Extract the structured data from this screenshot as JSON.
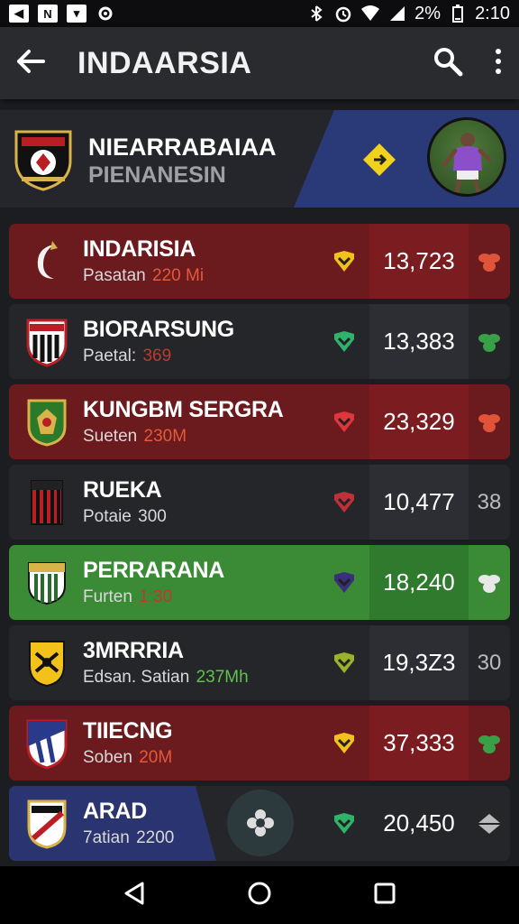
{
  "status_bar": {
    "left_icons": [
      "back-box-icon",
      "notification-n-icon",
      "mail-icon",
      "settings-icon"
    ],
    "battery": "2%",
    "time": "2:10"
  },
  "app_bar": {
    "title": "INDAARSIA"
  },
  "banner": {
    "title": "NIEARRABAIAA",
    "subtitle": "PIENANESIN"
  },
  "rows": [
    {
      "name": "INDARISIA",
      "sub_prefix": "Pasatan",
      "sub_value": "220 Mi",
      "sub_color": "#e25a3a",
      "score": "13,723",
      "tail": "",
      "style": "red",
      "trend_color": "#f2c21b",
      "trend_icon": "down-chevron-icon",
      "tail_icon_color": "#e0553a"
    },
    {
      "name": "BIORARSUNG",
      "sub_prefix": "Paetal:",
      "sub_value": "369",
      "sub_color": "#c0392b",
      "score": "13,383",
      "tail": "",
      "style": "dark",
      "trend_color": "#2fb36a",
      "trend_icon": "down-chevron-icon",
      "tail_icon_color": "#3aa048"
    },
    {
      "name": "KUNGBM SERGRA",
      "sub_prefix": "Sueten",
      "sub_value": "230M",
      "sub_color": "#e25a3a",
      "score": "23,329",
      "tail": "",
      "style": "red",
      "trend_color": "#e0353a",
      "trend_icon": "down-chevron-icon",
      "tail_icon_color": "#e0553a"
    },
    {
      "name": "RUEKA",
      "sub_prefix": "Potaie",
      "sub_value": "300",
      "sub_color": "#d9d9d9",
      "score": "10,477",
      "tail": "38",
      "style": "dark",
      "trend_color": "#c0303a",
      "trend_icon": "down-chevron-icon",
      "tail_icon_color": ""
    },
    {
      "name": "PERRARANA",
      "sub_prefix": "Furten",
      "sub_value": "1:30",
      "sub_color": "#c0392b",
      "score": "18,240",
      "tail": "",
      "style": "green",
      "trend_color": "#3a2f7a",
      "trend_icon": "down-chevron-icon",
      "tail_icon_color": "#e8e8e8"
    },
    {
      "name": "3MRRRIA",
      "sub_prefix": "Edsan. Satian",
      "sub_value": "237Mh",
      "sub_color": "#5fc24a",
      "score": "19,3Z3",
      "tail": "30",
      "style": "dark",
      "trend_color": "#9ab22a",
      "trend_icon": "down-chevron-icon",
      "tail_icon_color": ""
    },
    {
      "name": "TIIECNG",
      "sub_prefix": "Soben",
      "sub_value": "20M",
      "sub_color": "#e25a3a",
      "score": "37,333",
      "tail": "",
      "style": "red",
      "trend_color": "#f2c21b",
      "trend_icon": "down-chevron-icon",
      "tail_icon_color": "#3aa048"
    },
    {
      "name": "ARAD",
      "sub_prefix": "7atian",
      "sub_value": "2200",
      "sub_color": "#d9d9d9",
      "score": "20,450",
      "tail": "",
      "style": "last",
      "trend_color": "#2fb36a",
      "trend_icon": "down-chevron-icon",
      "tail_icon_color": ""
    }
  ],
  "colors": {
    "background": "#1c1d21",
    "app_bar": "#2a2b2f",
    "row_red": "#6b1a1e",
    "row_green": "#3a8a36",
    "banner_blue": "#2a3a78"
  }
}
